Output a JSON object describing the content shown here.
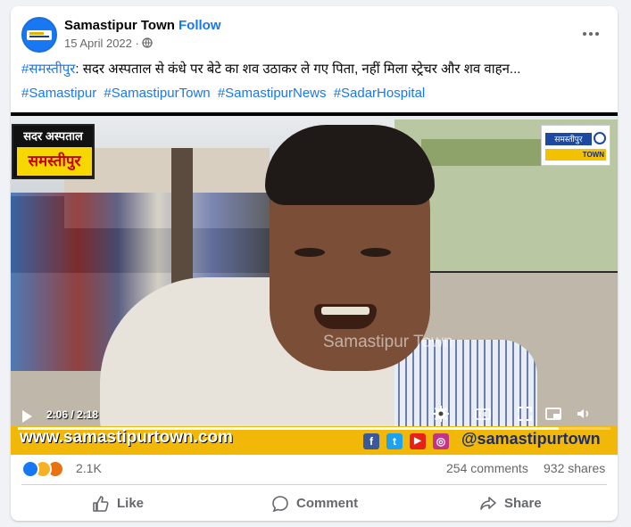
{
  "post": {
    "page_name": "Samastipur Town",
    "separator": "·",
    "follow_label": "Follow",
    "date": "15 April 2022 ·",
    "text_hashtag": "#समस्तीपुर",
    "text_body": ": सदर अस्पताल से कंधे पर बेटे का शव उठाकर ले गए पिता, नहीं मिला स्ट्रेचर और शव वाहन...",
    "hashtags": [
      "#Samastipur",
      "#SamastipurTown",
      "#SamastipurNews",
      "#SadarHospital"
    ]
  },
  "video": {
    "badge_left_top": "सदर अस्पताल",
    "badge_left_main": "समस्तीपुर",
    "badge_right_top": "समस्तीपुर",
    "badge_right_bottom": "TOWN",
    "watermark": "Samastipur Town",
    "bottom_left_text": "www.samastipurtown.com",
    "bottom_right_text": "@samastipurtown",
    "time": "2:06 / 2:18",
    "progress": 0.913,
    "social": [
      "f",
      "t",
      "▶",
      "◎"
    ]
  },
  "stats": {
    "reactions_count": "2.1K",
    "comments": "254 comments",
    "shares": "932 shares"
  },
  "actions": {
    "like": "Like",
    "comment": "Comment",
    "share": "Share"
  },
  "colors": {
    "accent": "#1877f2",
    "muted": "#65676b",
    "yellow_bar": "#f2b808"
  },
  "icons": [
    "globe-icon",
    "more-icon",
    "play-icon",
    "settings-icon",
    "captions-icon",
    "fullscreen-icon",
    "pip-icon",
    "volume-icon",
    "like-icon",
    "comment-icon",
    "share-icon"
  ]
}
